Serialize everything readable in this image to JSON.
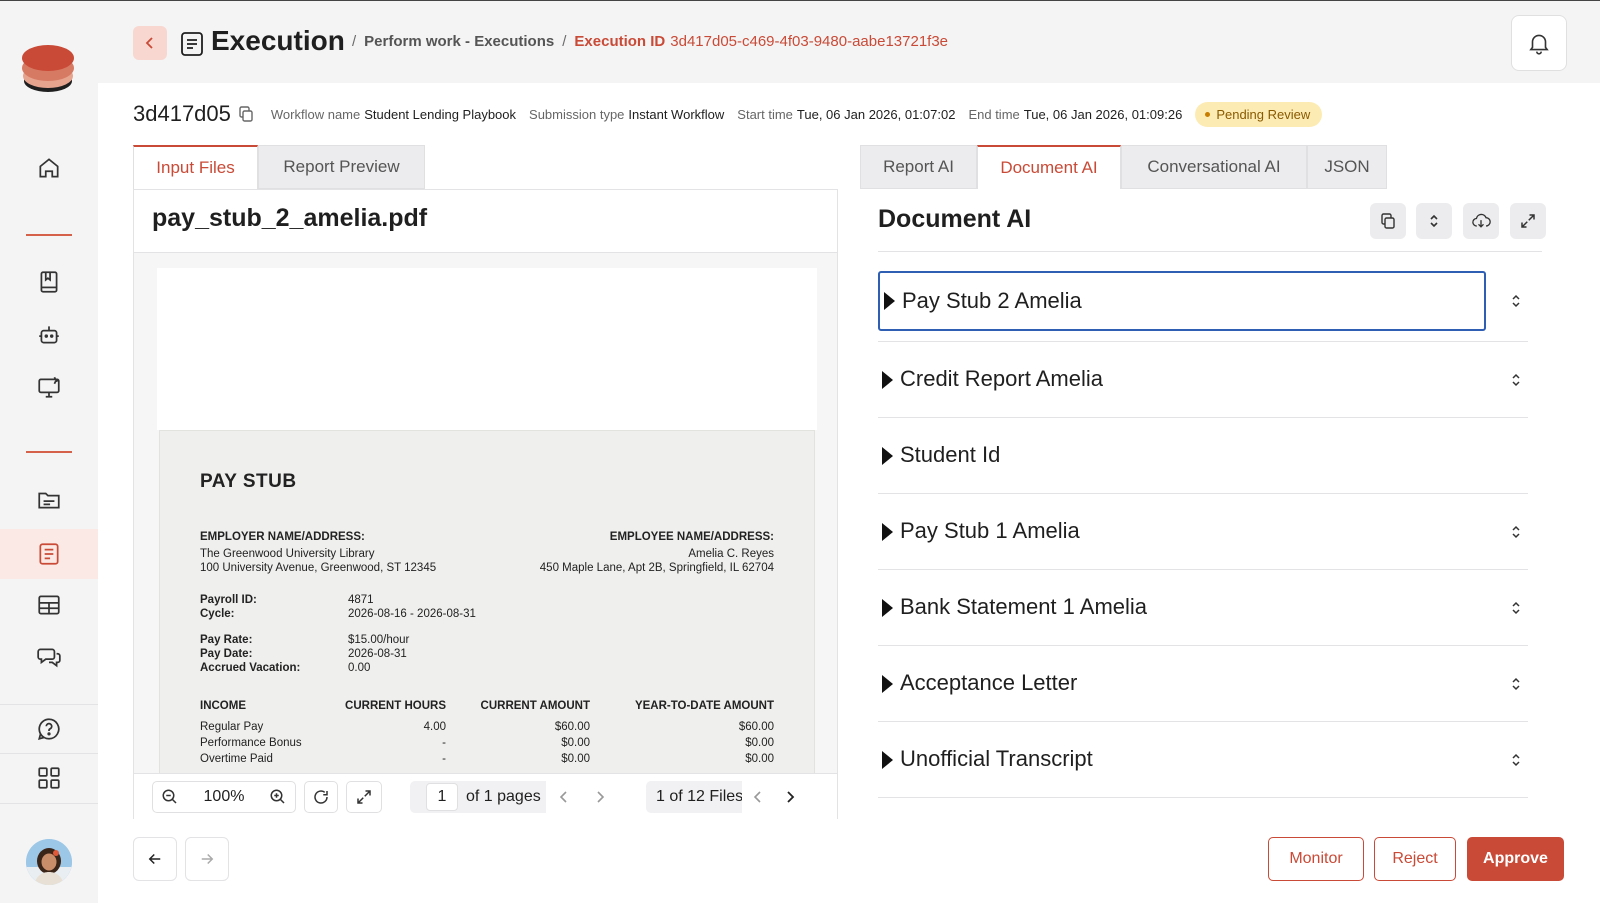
{
  "header": {
    "title": "Execution",
    "breadcrumb": {
      "parent": "Perform work - Executions",
      "current_label": "Execution ID",
      "current_id": "3d417d05-c469-4f03-9480-aabe13721f3e"
    }
  },
  "meta": {
    "short_id": "3d417d05",
    "workflow_label": "Workflow name",
    "workflow_value": "Student Lending Playbook",
    "submission_label": "Submission type",
    "submission_value": "Instant Workflow",
    "start_label": "Start time",
    "start_value": "Tue, 06 Jan 2026, 01:07:02",
    "end_label": "End time",
    "end_value": "Tue, 06 Jan 2026, 01:09:26",
    "status": "Pending Review"
  },
  "left_tabs": [
    "Input Files",
    "Report Preview"
  ],
  "right_tabs": [
    "Report AI",
    "Document AI",
    "Conversational AI",
    "JSON"
  ],
  "file": {
    "name": "pay_stub_2_amelia.pdf"
  },
  "paystub": {
    "title": "PAY STUB",
    "employer_label": "EMPLOYER NAME/ADDRESS:",
    "employer_name": "The Greenwood University Library",
    "employer_address": "100 University Avenue, Greenwood, ST 12345",
    "employee_label": "EMPLOYEE NAME/ADDRESS:",
    "employee_name": "Amelia C. Reyes",
    "employee_address": "450 Maple Lane, Apt 2B, Springfield, IL 62704",
    "payroll_id_label": "Payroll ID:",
    "payroll_id": "4871",
    "cycle_label": "Cycle:",
    "cycle": "2026-08-16 - 2026-08-31",
    "pay_rate_label": "Pay Rate:",
    "pay_rate": "$15.00/hour",
    "pay_date_label": "Pay Date:",
    "pay_date": "2026-08-31",
    "accrued_label": "Accrued Vacation:",
    "accrued": "0.00",
    "columns": [
      "INCOME",
      "CURRENT HOURS",
      "CURRENT AMOUNT",
      "YEAR-TO-DATE AMOUNT"
    ],
    "rows": [
      [
        "Regular Pay",
        "4.00",
        "$60.00",
        "$60.00"
      ],
      [
        "Performance Bonus",
        "-",
        "$0.00",
        "$0.00"
      ],
      [
        "Overtime Paid",
        "-",
        "$0.00",
        "$0.00"
      ]
    ]
  },
  "viewer": {
    "zoom": "100%",
    "page_current": "1",
    "page_total_text": "of 1 pages",
    "files_text": "1 of 12 Files"
  },
  "document_ai": {
    "title": "Document AI",
    "items": [
      "Pay Stub 2 Amelia",
      "Credit Report Amelia",
      "Student Id",
      "Pay Stub 1 Amelia",
      "Bank Statement 1 Amelia",
      "Acceptance Letter",
      "Unofficial Transcript"
    ]
  },
  "actions": {
    "monitor": "Monitor",
    "reject": "Reject",
    "approve": "Approve"
  },
  "colors": {
    "accent": "#c94a36",
    "status_bg": "#fdebb4",
    "focus_border": "#2f5fb3"
  }
}
